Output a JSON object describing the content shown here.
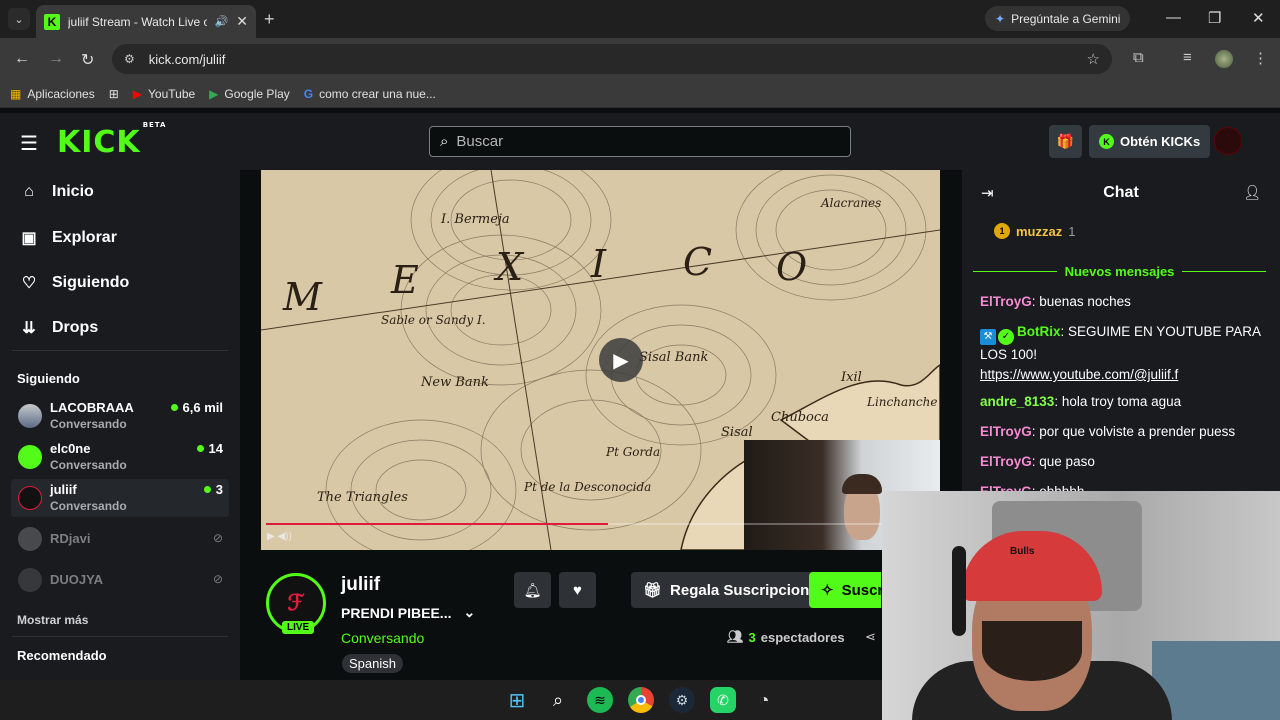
{
  "browser": {
    "tab_title": "juliif Stream - Watch Live on Kick",
    "tab_favicon": "K",
    "gemini_label": "Pregúntale a Gemini",
    "url": "kick.com/juliif",
    "bookmarks": [
      {
        "label": "Aplicaciones",
        "icon": "apps-grid-icon"
      },
      {
        "label": "YouTube",
        "icon": "youtube-icon"
      },
      {
        "label": "Google Play",
        "icon": "google-play-icon"
      },
      {
        "label": "como crear una nue...",
        "icon": "google-icon"
      }
    ]
  },
  "kick": {
    "logo": "KICK",
    "logo_beta": "BETA",
    "search_placeholder": "Buscar",
    "kicks_label": "Obtén KICKs",
    "brand_color": "#53fc18"
  },
  "sidebar": {
    "nav": [
      {
        "label": "Inicio",
        "icon": "home-icon"
      },
      {
        "label": "Explorar",
        "icon": "browse-icon"
      },
      {
        "label": "Siguiendo",
        "icon": "heart-icon"
      },
      {
        "label": "Drops",
        "icon": "drops-icon"
      }
    ],
    "following_title": "Siguiendo",
    "channels": [
      {
        "name": "LACOBRAAA",
        "category": "Conversando",
        "viewers": "6,6 mil"
      },
      {
        "name": "elc0ne",
        "category": "Conversando",
        "viewers": "14"
      },
      {
        "name": "juliif",
        "category": "Conversando",
        "viewers": "3"
      },
      {
        "name": "RDjavi",
        "category": "",
        "viewers": ""
      },
      {
        "name": "DUOJYA",
        "category": "",
        "viewers": ""
      }
    ],
    "show_more": "Mostrar más",
    "recommended_title": "Recomendado"
  },
  "video": {
    "map_labels": [
      "M",
      "E",
      "X",
      "I",
      "C",
      "O",
      "I. Bermeja",
      "Alacranes",
      "Sable or Sandy I.",
      "New Bank",
      "Sisal Bank",
      "Sisal",
      "Chuboca",
      "Ixil",
      "Linchanche",
      "The Triangles",
      "Pt Gorda",
      "Pt de la Desconocida"
    ],
    "progress_percent": 51
  },
  "stream": {
    "channel": "juliif",
    "title": "PRENDI PIBEE...",
    "category": "Conversando",
    "live_label": "LIVE",
    "language": "Spanish",
    "gift_label": "Regala Suscripciones",
    "subscribe_label": "Suscribirse",
    "viewers_count": "3",
    "viewers_label": "espectadores"
  },
  "chat": {
    "title": "Chat",
    "pinned_user": "muzzaz",
    "pinned_count": "1",
    "new_messages": "Nuevos mensajes",
    "messages": [
      {
        "user": "ElTroyG",
        "color": "#f78ad3",
        "text": "buenas noches"
      },
      {
        "user": "BotRix",
        "color": "#53fc18",
        "text": "SEGUIME EN YOUTUBE PARA LOS 100!",
        "link": "https://www.youtube.com/@juliif.f"
      },
      {
        "user": "andre_8133",
        "color": "#83ff4a",
        "text": "hola troy toma agua"
      },
      {
        "user": "ElTroyG",
        "color": "#f78ad3",
        "text": "por que volviste a prender puess"
      },
      {
        "user": "ElTroyG",
        "color": "#f78ad3",
        "text": "que paso"
      },
      {
        "user": "ElTroyG",
        "color": "#f78ad3",
        "text": "ohhhhh"
      }
    ]
  },
  "webcam": {
    "cap_logo": "Bulls"
  },
  "taskbar": {
    "apps": [
      "windows-start-icon",
      "search-icon",
      "spotify-icon",
      "chrome-icon",
      "steam-icon",
      "whatsapp-icon",
      "app-icon"
    ]
  }
}
